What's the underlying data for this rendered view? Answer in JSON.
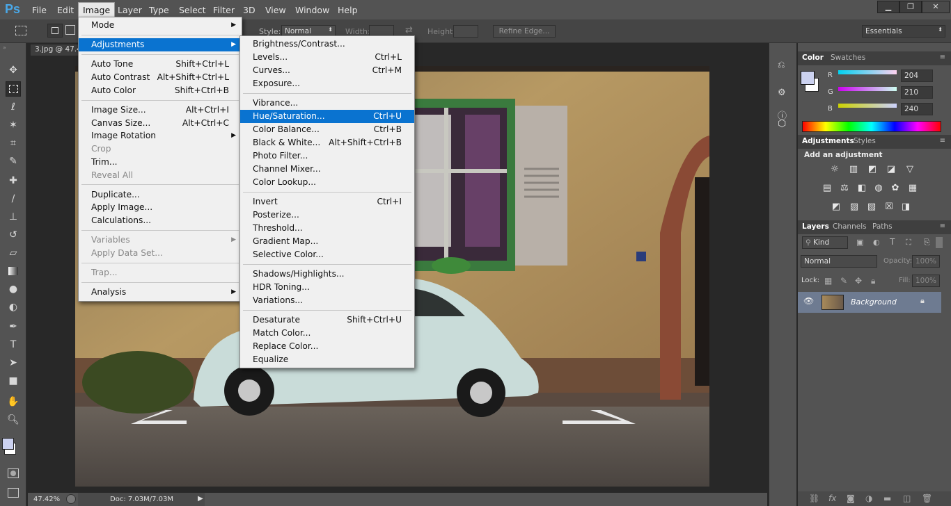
{
  "app": {
    "logo": "Ps"
  },
  "menubar": {
    "items": [
      "File",
      "Edit",
      "Image",
      "Layer",
      "Type",
      "Select",
      "Filter",
      "3D",
      "View",
      "Window",
      "Help"
    ],
    "active": "Image"
  },
  "window_controls": {
    "minimize": "▁",
    "restore": "❐",
    "close": "✕"
  },
  "options_bar": {
    "style_label": "Style:",
    "style_value": "Normal",
    "width_label": "Width:",
    "height_label": "Height:",
    "refine_edge": "Refine Edge...",
    "workspace": "Essentials"
  },
  "document": {
    "tab_title": "3.jpg @ 47.4"
  },
  "status": {
    "zoom": "47.42%",
    "doc": "Doc: 7.03M/7.03M"
  },
  "image_menu": {
    "items": [
      {
        "label": "Mode",
        "submenu": true
      },
      {
        "sep": true
      },
      {
        "label": "Adjustments",
        "submenu": true,
        "highlight": true
      },
      {
        "sep": true
      },
      {
        "label": "Auto Tone",
        "shortcut": "Shift+Ctrl+L"
      },
      {
        "label": "Auto Contrast",
        "shortcut": "Alt+Shift+Ctrl+L"
      },
      {
        "label": "Auto Color",
        "shortcut": "Shift+Ctrl+B"
      },
      {
        "sep": true
      },
      {
        "label": "Image Size...",
        "shortcut": "Alt+Ctrl+I"
      },
      {
        "label": "Canvas Size...",
        "shortcut": "Alt+Ctrl+C"
      },
      {
        "label": "Image Rotation",
        "submenu": true
      },
      {
        "label": "Crop",
        "disabled": true
      },
      {
        "label": "Trim..."
      },
      {
        "label": "Reveal All",
        "disabled": true
      },
      {
        "sep": true
      },
      {
        "label": "Duplicate..."
      },
      {
        "label": "Apply Image..."
      },
      {
        "label": "Calculations..."
      },
      {
        "sep": true
      },
      {
        "label": "Variables",
        "submenu": true,
        "disabled": true
      },
      {
        "label": "Apply Data Set...",
        "disabled": true
      },
      {
        "sep": true
      },
      {
        "label": "Trap...",
        "disabled": true
      },
      {
        "sep": true
      },
      {
        "label": "Analysis",
        "submenu": true
      }
    ]
  },
  "adjust_menu": {
    "items": [
      {
        "label": "Brightness/Contrast..."
      },
      {
        "label": "Levels...",
        "shortcut": "Ctrl+L"
      },
      {
        "label": "Curves...",
        "shortcut": "Ctrl+M"
      },
      {
        "label": "Exposure..."
      },
      {
        "sep": true
      },
      {
        "label": "Vibrance..."
      },
      {
        "label": "Hue/Saturation...",
        "shortcut": "Ctrl+U",
        "highlight": true
      },
      {
        "label": "Color Balance...",
        "shortcut": "Ctrl+B"
      },
      {
        "label": "Black & White...",
        "shortcut": "Alt+Shift+Ctrl+B"
      },
      {
        "label": "Photo Filter..."
      },
      {
        "label": "Channel Mixer..."
      },
      {
        "label": "Color Lookup..."
      },
      {
        "sep": true
      },
      {
        "label": "Invert",
        "shortcut": "Ctrl+I"
      },
      {
        "label": "Posterize..."
      },
      {
        "label": "Threshold..."
      },
      {
        "label": "Gradient Map..."
      },
      {
        "label": "Selective Color..."
      },
      {
        "sep": true
      },
      {
        "label": "Shadows/Highlights..."
      },
      {
        "label": "HDR Toning..."
      },
      {
        "label": "Variations..."
      },
      {
        "sep": true
      },
      {
        "label": "Desaturate",
        "shortcut": "Shift+Ctrl+U"
      },
      {
        "label": "Match Color..."
      },
      {
        "label": "Replace Color..."
      },
      {
        "label": "Equalize"
      }
    ]
  },
  "color_panel": {
    "tabs": [
      "Color",
      "Swatches"
    ],
    "r_label": "R",
    "g_label": "G",
    "b_label": "B",
    "r": "204",
    "g": "210",
    "b": "240",
    "fg_color": "#ccd2f0"
  },
  "adjustments_panel": {
    "tabs": [
      "Adjustments",
      "Styles"
    ],
    "heading": "Add an adjustment"
  },
  "layers_panel": {
    "tabs": [
      "Layers",
      "Channels",
      "Paths"
    ],
    "kind": "Kind",
    "blend": "Normal",
    "opacity_label": "Opacity:",
    "opacity": "100%",
    "lock_label": "Lock:",
    "fill_label": "Fill:",
    "fill": "100%",
    "layer_name": "Background"
  },
  "colors": {
    "accent": "#0a73d0",
    "panel": "#535353",
    "menu_bg": "#f0f0f0"
  }
}
